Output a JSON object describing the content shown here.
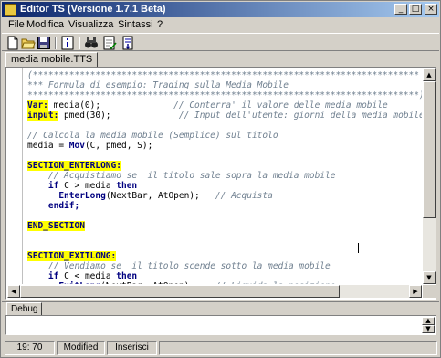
{
  "window": {
    "title": "Editor TS (Versione 1.7.1 Beta)",
    "controls": {
      "minimize": "_",
      "maximize": "□",
      "close": "×"
    }
  },
  "menu": [
    {
      "label": "File",
      "accel": "F"
    },
    {
      "label": "Modifica",
      "accel": "M"
    },
    {
      "label": "Visualizza",
      "accel": "V"
    },
    {
      "label": "Sintassi",
      "accel": "S"
    },
    {
      "label": "?",
      "accel": ""
    }
  ],
  "toolbar": {
    "icons": [
      "new-file-icon",
      "open-folder-icon",
      "save-icon",
      "info-icon",
      "find-binoculars-icon",
      "syntax-check-icon",
      "compile-icon"
    ]
  },
  "tabs": [
    {
      "label": "media mobile.TTS",
      "active": true
    }
  ],
  "editor": {
    "lines": [
      [
        {
          "t": "(**************************************************************************",
          "c": "cmt"
        }
      ],
      [
        {
          "t": "*** Formula di esempio: Trading sulla Media Mobile",
          "c": "cmt"
        }
      ],
      [
        {
          "t": "***************************************************************************)",
          "c": "cmt"
        }
      ],
      [
        {
          "t": "Var:",
          "c": "hl"
        },
        {
          "t": " media(0);              ",
          "c": ""
        },
        {
          "t": "// Conterra' il valore delle media mobile",
          "c": "cmt"
        }
      ],
      [
        {
          "t": "input:",
          "c": "hl"
        },
        {
          "t": " pmed(30);             ",
          "c": ""
        },
        {
          "t": "// Input dell'utente: giorni della media mobile",
          "c": "cmt"
        }
      ],
      [
        {
          "t": "",
          "c": ""
        }
      ],
      [
        {
          "t": "// Calcola la media mobile (Semplice) sul titolo",
          "c": "cmt"
        }
      ],
      [
        {
          "t": "media = ",
          "c": ""
        },
        {
          "t": "Mov",
          "c": "fn"
        },
        {
          "t": "(C, pmed, S);",
          "c": ""
        }
      ],
      [
        {
          "t": "",
          "c": ""
        }
      ],
      [
        {
          "t": "SECTION_ENTERLONG:",
          "c": "hl"
        }
      ],
      [
        {
          "t": "    ",
          "c": ""
        },
        {
          "t": "// Acquistiamo se  il titolo sale sopra la media mobile",
          "c": "cmt"
        }
      ],
      [
        {
          "t": "    ",
          "c": ""
        },
        {
          "t": "if",
          "c": "kw"
        },
        {
          "t": " C > media ",
          "c": ""
        },
        {
          "t": "then",
          "c": "kw"
        }
      ],
      [
        {
          "t": "      ",
          "c": ""
        },
        {
          "t": "EnterLong",
          "c": "fn"
        },
        {
          "t": "(NextBar, AtOpen);   ",
          "c": ""
        },
        {
          "t": "// Acquista",
          "c": "cmt"
        }
      ],
      [
        {
          "t": "    ",
          "c": ""
        },
        {
          "t": "endif;",
          "c": "kw"
        }
      ],
      [
        {
          "t": "",
          "c": ""
        }
      ],
      [
        {
          "t": "END_SECTION",
          "c": "hl"
        }
      ],
      [
        {
          "t": "",
          "c": ""
        }
      ],
      [
        {
          "t": "",
          "c": ""
        }
      ],
      [
        {
          "t": "SECTION_EXITLONG:",
          "c": "hl"
        }
      ],
      [
        {
          "t": "    ",
          "c": ""
        },
        {
          "t": "// Vendiamo se  il titolo scende sotto la media mobile",
          "c": "cmt"
        }
      ],
      [
        {
          "t": "    ",
          "c": ""
        },
        {
          "t": "if",
          "c": "kw"
        },
        {
          "t": " C < media ",
          "c": ""
        },
        {
          "t": "then",
          "c": "kw"
        }
      ],
      [
        {
          "t": "      ",
          "c": ""
        },
        {
          "t": "ExitLong",
          "c": "fn"
        },
        {
          "t": "(NextBar, AtOpen);    ",
          "c": ""
        },
        {
          "t": "// Liquida la posizione",
          "c": "cmt"
        }
      ]
    ]
  },
  "debug": {
    "tab_label": "Debug"
  },
  "status": {
    "position": "19: 70",
    "state": "Modified",
    "mode": "Inserisci"
  }
}
